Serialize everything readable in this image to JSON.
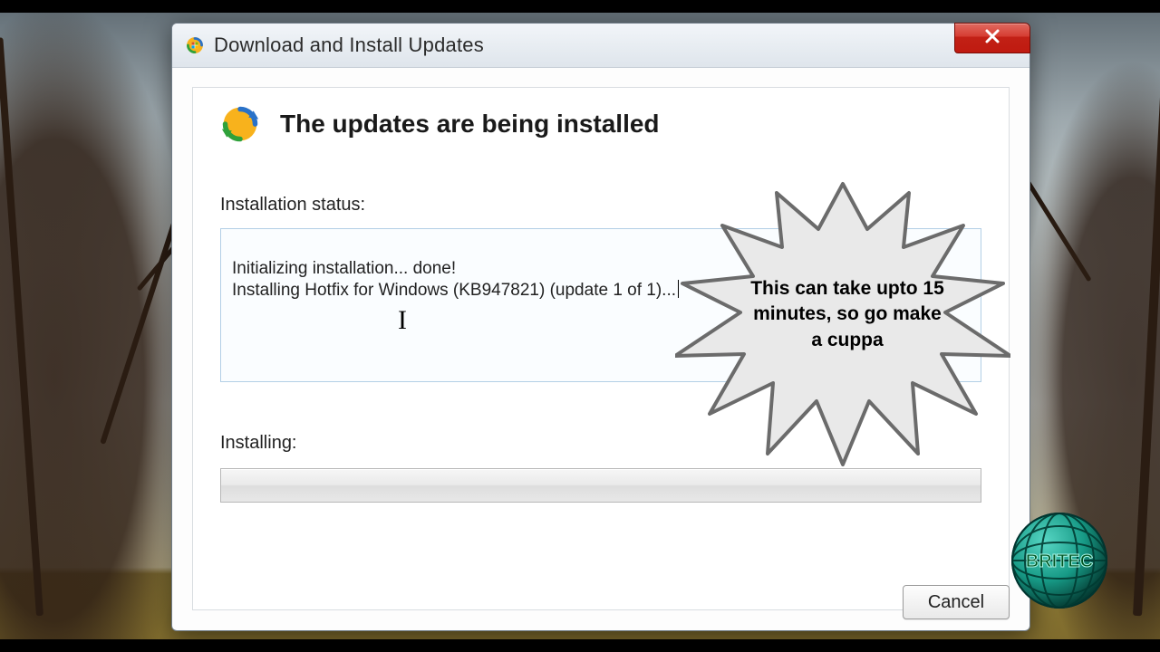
{
  "window": {
    "title": "Download and Install Updates"
  },
  "content": {
    "heading": "The updates are being installed",
    "status_label": "Installation status:",
    "status_lines": "Initializing installation... done!\nInstalling Hotfix for Windows (KB947821) (update 1 of 1)...",
    "installing_label": "Installing:",
    "cancel_label": "Cancel"
  },
  "callout": {
    "text": "This can take upto 15 minutes, so go make a cuppa"
  },
  "logo": {
    "text": "BRITEC"
  }
}
